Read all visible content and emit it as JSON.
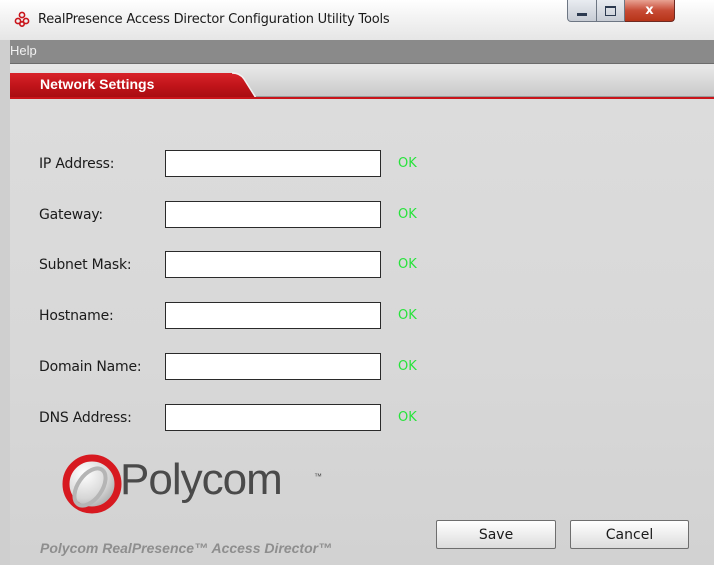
{
  "window": {
    "title": "RealPresence Access Director Configuration Utility Tools",
    "icon": "polycom-app-icon",
    "controls": {
      "minimize": "minimize-icon",
      "maximize": "maximize-icon",
      "close": "x"
    }
  },
  "menu": {
    "items": [
      {
        "label": "Help"
      }
    ]
  },
  "tabs": [
    {
      "label": "Network Settings",
      "active": true,
      "color": "#c9141a"
    }
  ],
  "form": {
    "fields": [
      {
        "label": "IP Address:",
        "value": "",
        "status": "OK"
      },
      {
        "label": "Gateway:",
        "value": "",
        "status": "OK"
      },
      {
        "label": "Subnet Mask:",
        "value": "",
        "status": "OK"
      },
      {
        "label": "Hostname:",
        "value": "",
        "status": "OK"
      },
      {
        "label": "Domain Name:",
        "value": "",
        "status": "OK"
      },
      {
        "label": "DNS Address:",
        "value": "",
        "status": "OK"
      }
    ],
    "status_color": "#27e33b"
  },
  "branding": {
    "logo_text": "Polycom",
    "logo_tm": "™",
    "logo_color": "#c9141a",
    "product_name": "Polycom RealPresence™ Access Director™"
  },
  "buttons": {
    "save": "Save",
    "cancel": "Cancel"
  }
}
